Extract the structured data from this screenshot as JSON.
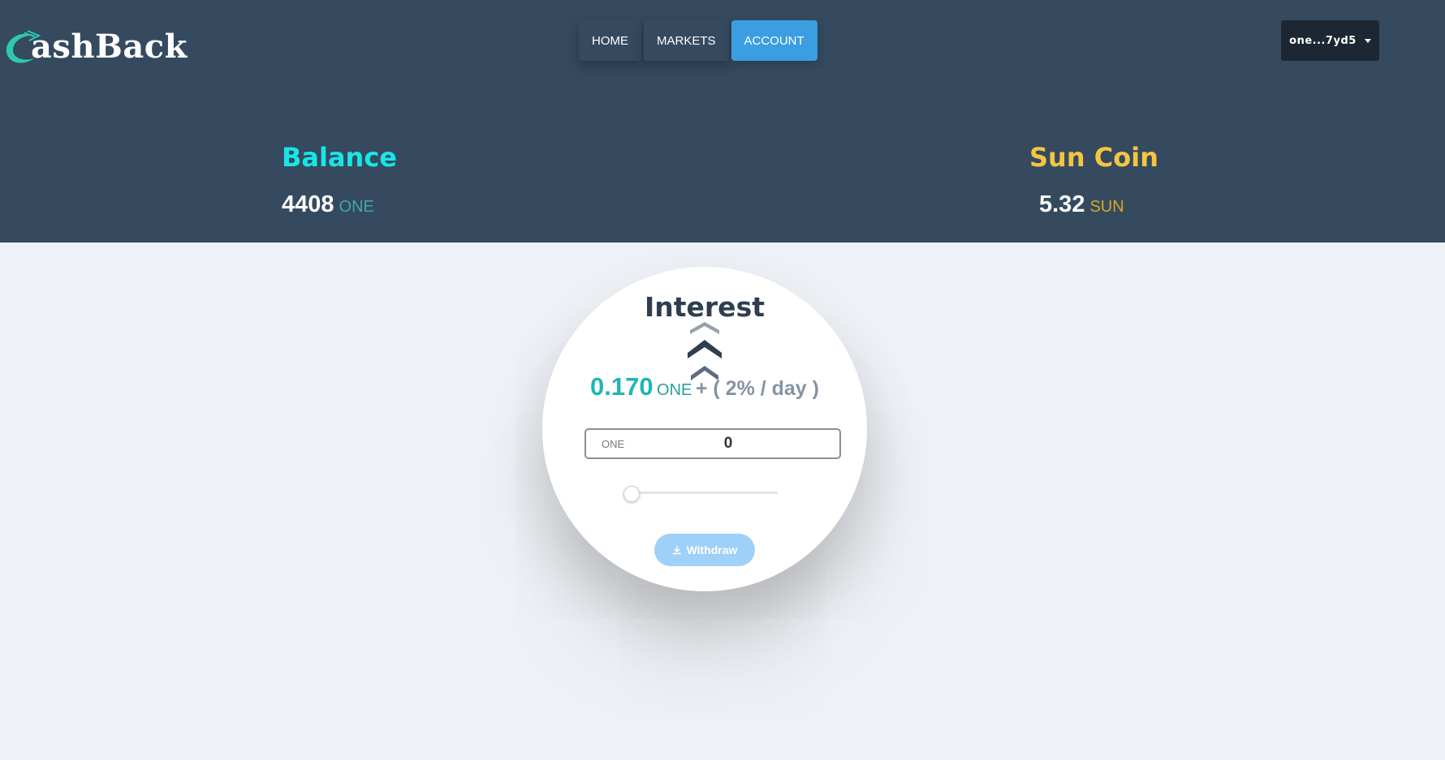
{
  "brand": {
    "logo_text": "ashBack"
  },
  "nav": {
    "items": [
      {
        "label": "HOME"
      },
      {
        "label": "MARKETS"
      },
      {
        "label": "ACCOUNT"
      }
    ],
    "active": "ACCOUNT"
  },
  "wallet": {
    "address": "one...7yd5",
    "icon": "chevron-down-icon"
  },
  "balance": {
    "title": "Balance",
    "value": "4408",
    "unit": "ONE"
  },
  "suncoin": {
    "title": "Sun Coin",
    "value": "5.32",
    "unit": "SUN"
  },
  "interest": {
    "title": "Interest",
    "amount": "0.170",
    "unit": "ONE",
    "rate_text": "+ ( 2% / day )",
    "input_label": "ONE",
    "input_value": "0",
    "slider_value": 0,
    "withdraw_label": "Withdraw",
    "withdraw_icon": "download-icon"
  },
  "colors": {
    "header_bg": "#354a5f",
    "page_bg": "#eef1f5",
    "accent": "#3a9ee0",
    "balance_title": "#18e6e6",
    "suncoin_title": "#f4c542",
    "interest_amount": "#1fb5b5"
  }
}
